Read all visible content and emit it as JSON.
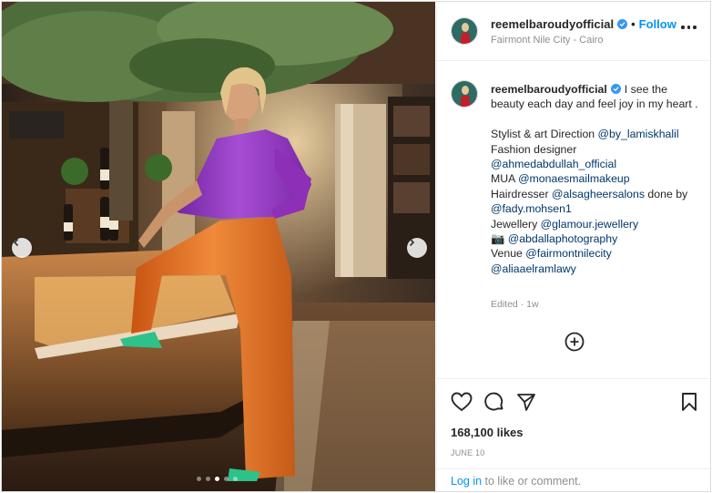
{
  "post": {
    "username": "reemelbaroudyofficial",
    "follow_separator": "•",
    "follow_label": "Follow",
    "location": "Fairmont Nile City - Cairo",
    "caption": {
      "lines": [
        {
          "text": "I see the beauty each day and feel joy in my heart .",
          "is_intro": true
        },
        {
          "text": ""
        },
        {
          "prefix": "Stylist & art Direction ",
          "mention": "@by_lamiskhalil"
        },
        {
          "prefix": "Fashion designer",
          "mention": ""
        },
        {
          "prefix": "",
          "mention": "@ahmedabdullah_official"
        },
        {
          "prefix": "MUA ",
          "mention": "@monaesmailmakeup"
        },
        {
          "prefix": "Hairdresser ",
          "mention": "@alsagheersalons",
          "suffix": " done by"
        },
        {
          "prefix": "",
          "mention": "@fady.mohsen1"
        },
        {
          "prefix": "Jewellery ",
          "mention": "@glamour.jewellery"
        },
        {
          "prefix": "📷 ",
          "mention": "@abdallaphotography"
        },
        {
          "prefix": "Venue ",
          "mention": "@fairmontnilecity"
        },
        {
          "prefix": "",
          "mention": "@aliaaelramlawy"
        }
      ]
    },
    "edited_label": "Edited",
    "edited_age": "1w",
    "likes": "168,100 likes",
    "date": "JUNE 10",
    "login_link": "Log in",
    "login_rest": " to like or comment."
  },
  "carousel": {
    "slide_count": 5,
    "active_index": 2
  },
  "icons": {
    "header_more": "more-horizontal-icon",
    "verified": "verified-badge-icon",
    "prev": "chevron-left-icon",
    "next": "chevron-right-icon",
    "add_comments": "plus-circle-icon",
    "like": "heart-icon",
    "comment": "comment-icon",
    "share": "share-icon",
    "save": "bookmark-icon"
  },
  "colors": {
    "link": "#0095f6",
    "mention": "#00376b",
    "verified": "#3897f0",
    "top_color": "#8e2fb8",
    "pants_color": "#e8731f",
    "shoe_color": "#2cc28a"
  }
}
